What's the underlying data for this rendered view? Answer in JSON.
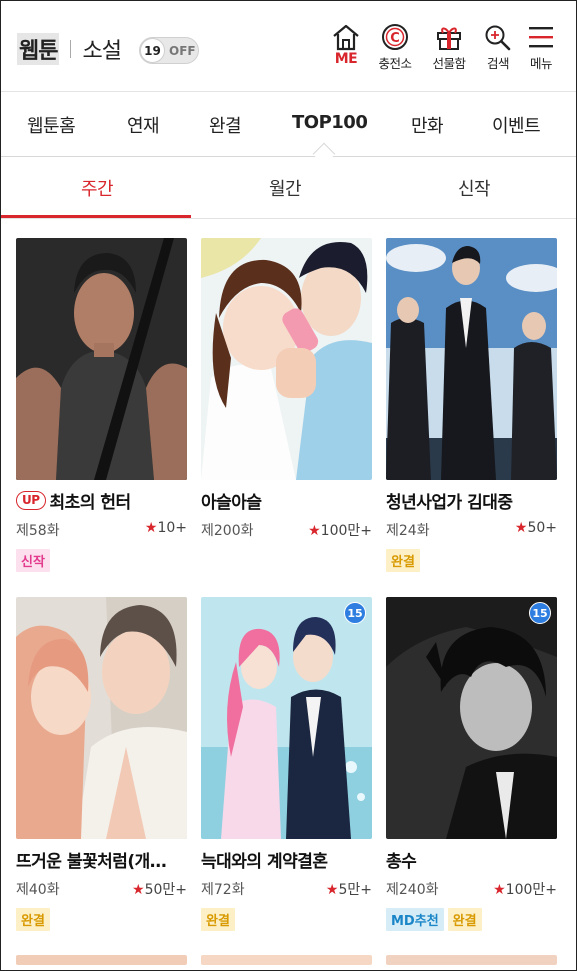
{
  "header": {
    "brand_webtoon": "웹툰",
    "brand_novel": "소설",
    "adult_toggle": {
      "age": "19",
      "state": "OFF"
    },
    "icons": [
      {
        "name": "home-icon",
        "label": "ME"
      },
      {
        "name": "charge-icon",
        "label": "충전소"
      },
      {
        "name": "gift-icon",
        "label": "선물함"
      },
      {
        "name": "search-icon",
        "label": "검색"
      },
      {
        "name": "menu-icon",
        "label": "메뉴"
      }
    ]
  },
  "category_nav": [
    "웹툰홈",
    "연재",
    "완결",
    "TOP100",
    "만화",
    "이벤트"
  ],
  "category_active": "TOP100",
  "period_tabs": [
    "주간",
    "월간",
    "신작"
  ],
  "period_active": "주간",
  "cards": [
    {
      "title": "최초의 헌터",
      "up": "UP",
      "episode": "제58화",
      "rating": "10+",
      "badges": [
        "신작"
      ]
    },
    {
      "title": "아슬아슬",
      "episode": "제200화",
      "rating": "100만+",
      "badges": []
    },
    {
      "title": "청년사업가 김대중",
      "episode": "제24화",
      "rating": "50+",
      "badges": [
        "완결"
      ]
    },
    {
      "title": "뜨거운 불꽃처럼(개…",
      "episode": "제40화",
      "rating": "50만+",
      "badges": [
        "완결"
      ]
    },
    {
      "title": "늑대와의 계약결혼",
      "episode": "제72화",
      "rating": "5만+",
      "badges": [
        "완결"
      ],
      "age": "15"
    },
    {
      "title": "총수",
      "episode": "제240화",
      "rating": "100만+",
      "badges": [
        "MD추천",
        "완결"
      ],
      "age": "15"
    }
  ],
  "colors": {
    "accent": "#d8262c",
    "new_badge": "#e23a8d",
    "done_badge": "#d89a00",
    "md_badge": "#1b86c7",
    "age_badge": "#2d7ee0"
  }
}
